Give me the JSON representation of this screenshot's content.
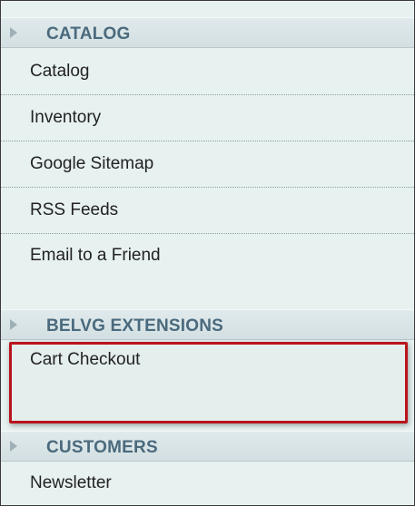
{
  "menu": {
    "sections": [
      {
        "title": "CATALOG",
        "items": [
          "Catalog",
          "Inventory",
          "Google Sitemap",
          "RSS Feeds",
          "Email to a Friend"
        ]
      },
      {
        "title": "BELVG EXTENSIONS",
        "items": [
          "Cart Checkout"
        ]
      },
      {
        "title": "CUSTOMERS",
        "items": [
          "Newsletter"
        ]
      }
    ]
  },
  "highlight_color": "#b8141d",
  "icons": {
    "section_arrow": "triangle-right-icon"
  }
}
